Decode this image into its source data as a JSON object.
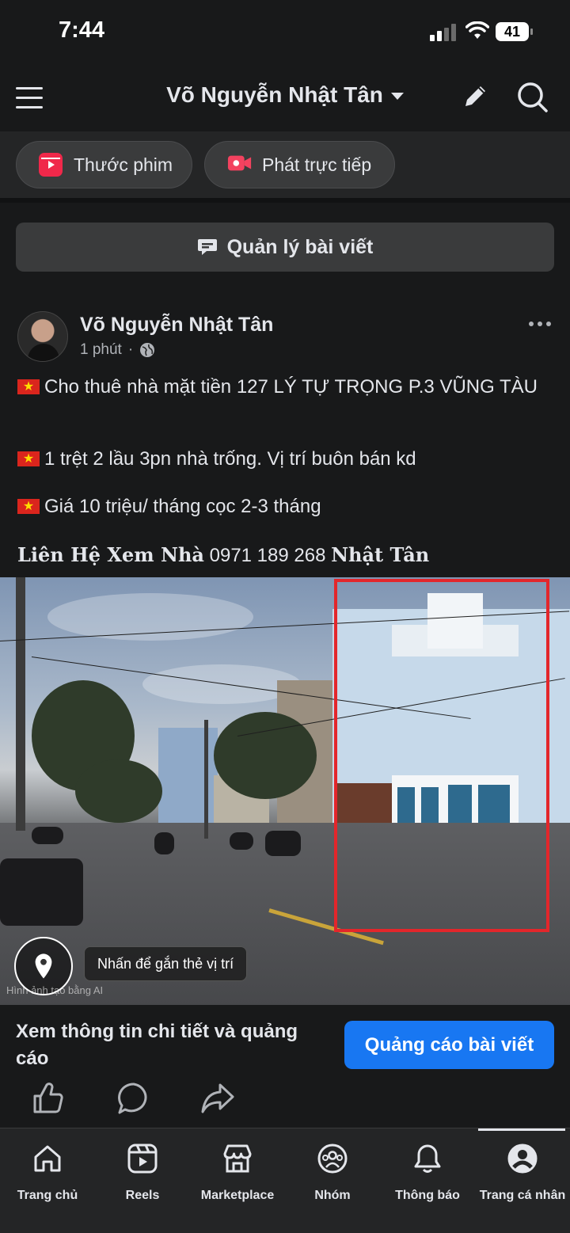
{
  "status_bar": {
    "time": "7:44",
    "battery": "41"
  },
  "header": {
    "profile_name": "Võ Nguyễn Nhật Tân"
  },
  "chips": {
    "reels": "Thước phim",
    "live": "Phát trực tiếp"
  },
  "manage_posts": "Quản lý bài viết",
  "post": {
    "author": "Võ Nguyễn Nhật Tân",
    "time": "1 phút",
    "separator": "·",
    "lines": [
      "Cho thuê nhà mặt tiền 127 LÝ TỰ TRỌNG P.3 VŨNG TÀU",
      "1 trệt 2 lầu 3pn nhà trống. Vị trí buôn bán kd",
      "Giá 10 triệu/ tháng cọc 2-3 tháng"
    ],
    "contact_prefix": "Liên Hệ Xem Nhà",
    "contact_phone": "0971 189 268",
    "contact_name": "Nhật Tân",
    "photo": {
      "location_hint": "Nhấn để gắn thẻ vị trí",
      "ai_label": "Hình ảnh tạo bằng AI"
    }
  },
  "boost": {
    "text": "Xem thông tin chi tiết và quảng cáo",
    "button": "Quảng cáo bài viết"
  },
  "bottom_nav": [
    {
      "label": "Trang chủ",
      "icon": "home-icon"
    },
    {
      "label": "Reels",
      "icon": "reels-icon"
    },
    {
      "label": "Marketplace",
      "icon": "marketplace-icon"
    },
    {
      "label": "Nhóm",
      "icon": "groups-icon"
    },
    {
      "label": "Thông báo",
      "icon": "bell-icon"
    },
    {
      "label": "Trang cá nhân",
      "icon": "profile-icon"
    }
  ],
  "colors": {
    "background": "#18191a",
    "surface": "#242526",
    "accent": "#1877f2",
    "frame": "#e3262b"
  }
}
